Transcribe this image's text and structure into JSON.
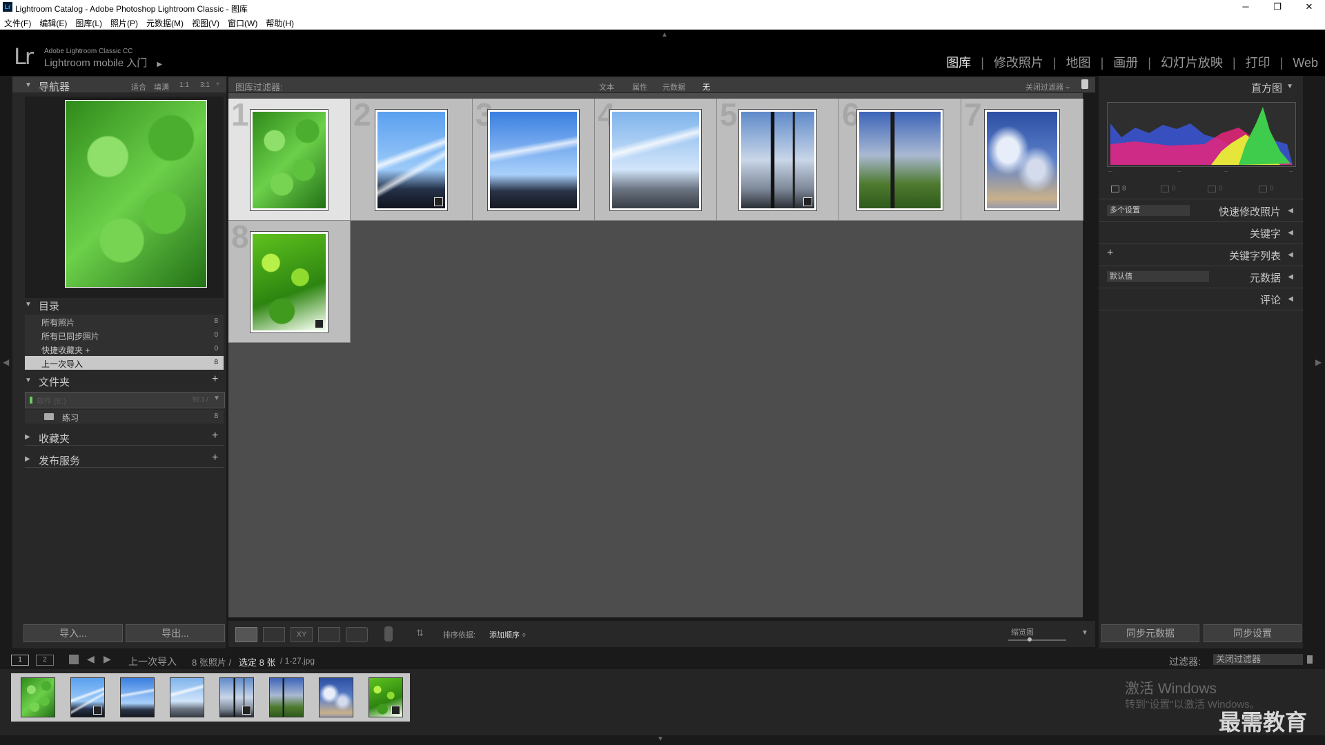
{
  "window": {
    "app_icon": "Lr",
    "title": "Lightroom Catalog - Adobe Photoshop Lightroom Classic - 图库",
    "minimize": "─",
    "restore": "❐",
    "close": "✕"
  },
  "menu": [
    "文件(F)",
    "编辑(E)",
    "图库(L)",
    "照片(P)",
    "元数据(M)",
    "视图(V)",
    "窗口(W)",
    "帮助(H)"
  ],
  "identity": {
    "logo": "Lr",
    "product": "Adobe Lightroom Classic CC",
    "mobile": "Lightroom mobile 入门",
    "arrow": "▶"
  },
  "modules": [
    "图库",
    "修改照片",
    "地图",
    "画册",
    "幻灯片放映",
    "打印",
    "Web"
  ],
  "active_module": "图库",
  "navigator": {
    "title": "导航器",
    "zoom_options": [
      "适合",
      "填满",
      "1:1",
      "3:1"
    ],
    "zoom_arrow": "÷"
  },
  "catalog": {
    "title": "目录",
    "items": [
      {
        "label": "所有照片",
        "count": "8"
      },
      {
        "label": "所有已同步照片",
        "count": "0"
      },
      {
        "label": "快捷收藏夹 +",
        "count": "0"
      },
      {
        "label": "上一次导入",
        "count": "8"
      }
    ]
  },
  "folders": {
    "title": "文件夹",
    "add": "+",
    "volume_label": "软件 (E:)",
    "volume_size": "92.1 /",
    "folder_name": "练习",
    "folder_count": "8"
  },
  "collections": {
    "title": "收藏夹",
    "add": "+"
  },
  "publish": {
    "title": "发布服务",
    "add": "+"
  },
  "left_buttons": {
    "import": "导入...",
    "export": "导出..."
  },
  "filter_bar": {
    "label": "图库过滤器:",
    "tabs": [
      "文本",
      "属性",
      "元数据",
      "无"
    ],
    "close_filter": "关闭过滤器 ÷",
    "lock_icon": "lock-icon"
  },
  "photos": [
    {
      "num": "1",
      "style": "ph-clover",
      "badge": false
    },
    {
      "num": "2",
      "style": "ph-sky1",
      "badge": true
    },
    {
      "num": "3",
      "style": "ph-sky2",
      "badge": false
    },
    {
      "num": "4",
      "style": "ph-sky3",
      "badge": false
    },
    {
      "num": "5",
      "style": "ph-pole1",
      "badge": true
    },
    {
      "num": "6",
      "style": "ph-pole2",
      "badge": false
    },
    {
      "num": "7",
      "style": "ph-clouds",
      "badge": false
    },
    {
      "num": "8",
      "style": "ph-leaves",
      "badge": true
    }
  ],
  "toolbar": {
    "sort_label": "排序依据:",
    "sort_value": "添加顺序 ÷",
    "thumb_label": "缩览图",
    "dropdown": "▼"
  },
  "right_panel": {
    "histogram_title": "直方图",
    "histogram_counts": [
      "8",
      "0",
      "0",
      "0"
    ],
    "quick_develop": "快速修改照片",
    "preset_value": "多个设置",
    "keywords": "关键字",
    "keyword_list": "关键字列表",
    "keyword_add": "+",
    "metadata": "元数据",
    "metadata_preset": "默认值",
    "comments": "评论",
    "sync_metadata": "同步元数据",
    "sync_settings": "同步设置"
  },
  "filmstrip_bar": {
    "screen1": "1",
    "screen2": "2",
    "source": "上一次导入",
    "info": "8 张照片 /",
    "selected": "选定 8 张",
    "filename": "/ 1-27.jpg",
    "filter_label": "过滤器:",
    "filter_value": "关闭过滤器"
  },
  "watermark": {
    "activate_title": "激活 Windows",
    "activate_sub": "转到\"设置\"以激活 Windows。",
    "brand": "最需教育"
  }
}
